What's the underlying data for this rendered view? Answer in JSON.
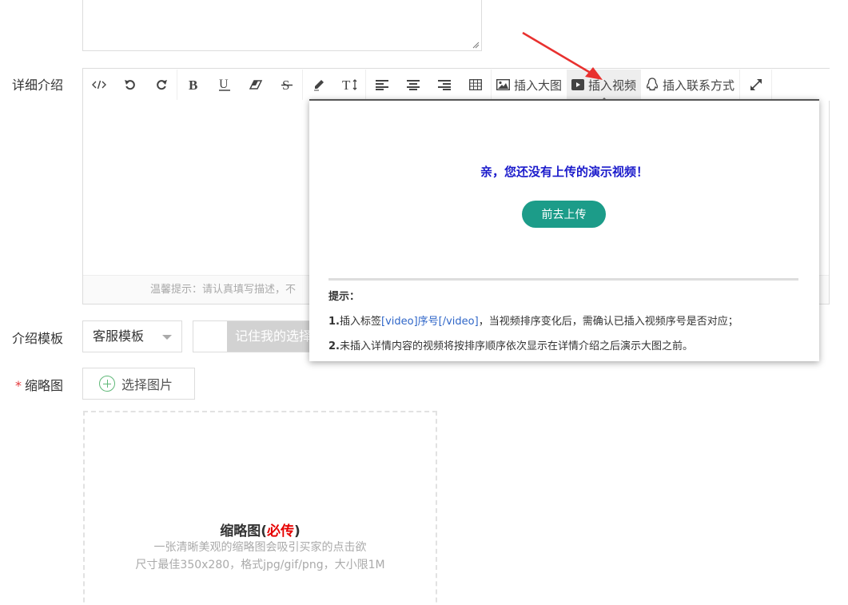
{
  "form": {
    "detail_label": "详细介绍",
    "template_label": "介绍模板",
    "thumbnail_required": "*",
    "thumbnail_label": "缩略图"
  },
  "toolbar": {
    "insert_image_label": "插入大图",
    "insert_video_label": "插入视频",
    "insert_contact_label": "插入联系方式"
  },
  "editor": {
    "footer_hint": "温馨提示：请认真填写描述，不"
  },
  "popup": {
    "message": "亲，您还没有上传的演示视频！",
    "upload_button": "前去上传",
    "tips_title": "提示：",
    "tip1_num": "1.",
    "tip1_pre": "插入标签",
    "tip1_tag": "[video]序号[/video]",
    "tip1_post": "，当视频排序变化后，需确认已插入视频序号是否对应；",
    "tip2_num": "2.",
    "tip2_text": "未插入详情内容的视频将按排序顺序依次显示在详情介绍之后演示大图之前。"
  },
  "template": {
    "selected": "客服模板",
    "remember_label": "记住我的选择"
  },
  "thumbnail": {
    "choose_button": "选择图片",
    "title": "缩略图",
    "paren_open": "(",
    "must_upload": "必传",
    "paren_close": ")",
    "desc1": "一张清晰美观的缩略图会吸引买家的点击欲",
    "desc2": "尺寸最佳350x280，格式jpg/gif/png，大小限1M"
  },
  "colors": {
    "accent": "#1c9c89",
    "required": "#e4393c",
    "message": "#1a1acb",
    "arrow": "#e8312f"
  }
}
